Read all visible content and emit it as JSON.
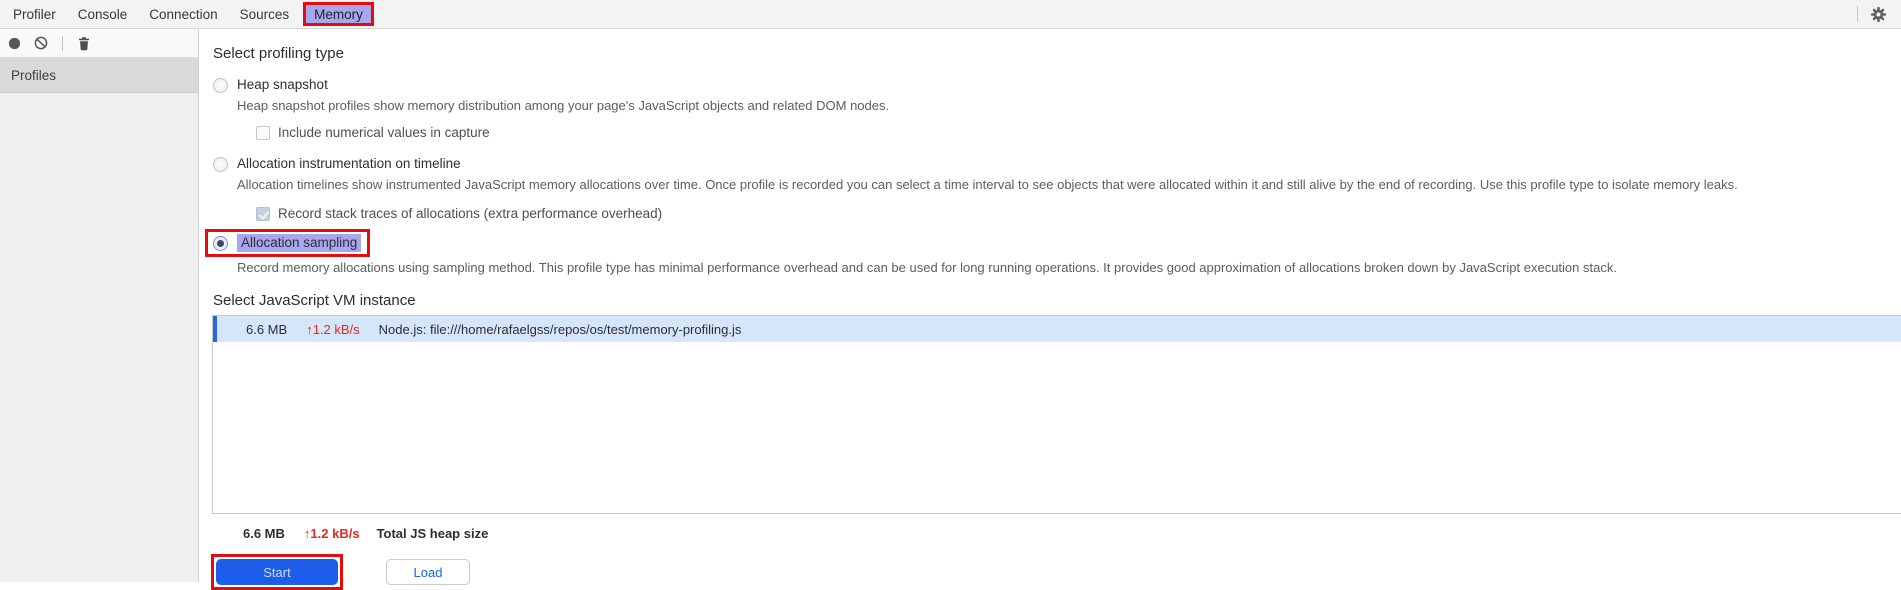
{
  "tabbar": {
    "tabs": [
      {
        "label": "Profiler",
        "active": false
      },
      {
        "label": "Console",
        "active": false
      },
      {
        "label": "Connection",
        "active": false
      },
      {
        "label": "Sources",
        "active": false
      },
      {
        "label": "Memory",
        "active": true,
        "annotated": true
      }
    ],
    "settings_icon": "gear-icon"
  },
  "toolbar": {
    "icons": [
      {
        "name": "record-icon"
      },
      {
        "name": "clear-icon"
      },
      {
        "name": "trash-icon"
      }
    ]
  },
  "sidebar": {
    "header": "Profiles"
  },
  "profiling": {
    "title": "Select profiling type",
    "options": [
      {
        "label": "Heap snapshot",
        "selected": false,
        "description": "Heap snapshot profiles show memory distribution among your page's JavaScript objects and related DOM nodes.",
        "sub_checkbox": {
          "label": "Include numerical values in capture",
          "checked": false,
          "disabled": false
        }
      },
      {
        "label": "Allocation instrumentation on timeline",
        "selected": false,
        "description": "Allocation timelines show instrumented JavaScript memory allocations over time. Once profile is recorded you can select a time interval to see objects that were allocated within it and still alive by the end of recording. Use this profile type to isolate memory leaks.",
        "sub_checkbox": {
          "label": "Record stack traces of allocations (extra performance overhead)",
          "checked": true,
          "disabled": true
        }
      },
      {
        "label": "Allocation sampling",
        "selected": true,
        "annotated": true,
        "description": "Record memory allocations using sampling method. This profile type has minimal performance overhead and can be used for long running operations. It provides good approximation of allocations broken down by JavaScript execution stack."
      }
    ]
  },
  "vm": {
    "title": "Select JavaScript VM instance",
    "rows": [
      {
        "size": "6.6 MB",
        "rate": "↑1.2 kB/s",
        "name": "Node.js: file:///home/rafaelgss/repos/os/test/memory-profiling.js",
        "selected": true
      }
    ],
    "total": {
      "size": "6.6 MB",
      "rate": "↑1.2 kB/s",
      "label": "Total JS heap size"
    }
  },
  "actions": {
    "start_label": "Start",
    "load_label": "Load"
  },
  "colors": {
    "annotation_red": "#e40d0d",
    "highlight_lavender": "#a7a7ef",
    "selected_row_bg": "#d6e6fa",
    "selected_row_accent": "#2a66dd",
    "rate_red": "#de2b22",
    "primary_button_bg": "#1c5de9",
    "link_blue": "#1a63e8"
  }
}
